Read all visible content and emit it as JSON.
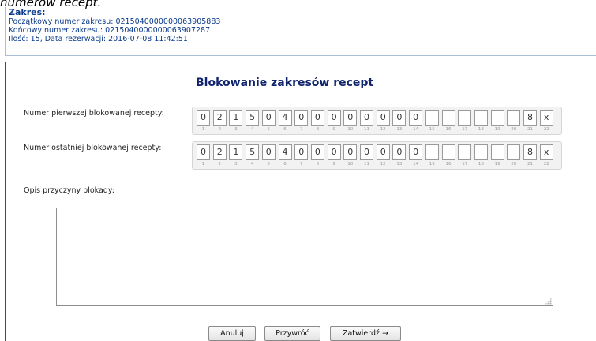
{
  "caption": "numerów recept.",
  "range_info": {
    "title": "Zakres:",
    "start_line": "Początkowy numer zakresu: 0215040000000063905883",
    "end_line": "Końcowy numer zakresu: 0215040000000063907287",
    "count_line": "Ilość: 15,   Data rezerwacji: 2016-07-08 11:42:51"
  },
  "form": {
    "title": "Blokowanie zakresów recept",
    "first_label": "Numer pierwszej blokowanej recepty:",
    "last_label": "Numer ostatniej blokowanej recepty:",
    "reason_label": "Opis przyczyny blokady:",
    "reason_value": ""
  },
  "first_digits": [
    "0",
    "2",
    "1",
    "5",
    "0",
    "4",
    "0",
    "0",
    "0",
    "0",
    "0",
    "0",
    "0",
    "0",
    "",
    "",
    "",
    "",
    "",
    "",
    "8",
    "x"
  ],
  "last_digits": [
    "0",
    "2",
    "1",
    "5",
    "0",
    "4",
    "0",
    "0",
    "0",
    "0",
    "0",
    "0",
    "0",
    "0",
    "",
    "",
    "",
    "",
    "",
    "",
    "8",
    "x"
  ],
  "digit_positions": [
    "1",
    "2",
    "3",
    "4",
    "5",
    "6",
    "7",
    "8",
    "9",
    "10",
    "11",
    "12",
    "13",
    "14",
    "15",
    "16",
    "17",
    "18",
    "19",
    "20",
    "21",
    "22"
  ],
  "buttons": {
    "cancel": "Anuluj",
    "restore": "Przywróć",
    "confirm": "Zatwierdź →"
  }
}
